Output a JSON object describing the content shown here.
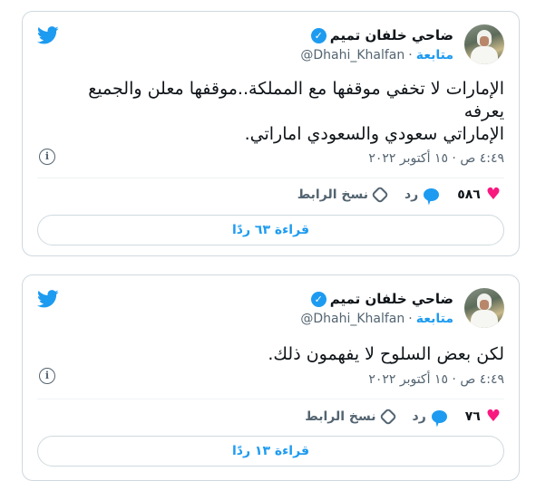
{
  "tweets": [
    {
      "author_name": "ضاحي خلفان تميم",
      "handle": "@Dhahi_Khalfan",
      "follow_label": "متابعة",
      "separator": "·",
      "text_lines": [
        "الإمارات لا تخفي موقفها مع المملكة..موقفها معلن والجميع",
        "يعرفه",
        "الإماراتي سعودي والسعودي اماراتي."
      ],
      "timestamp": "٤:٤٩ ص · ١٥ أكتوبر ٢٠٢٢",
      "likes": "٥٨٦",
      "reply_label": "رد",
      "copy_link_label": "نسخ الرابط",
      "read_replies_label": "قراءة ٦٣ ردًا"
    },
    {
      "author_name": "ضاحي خلفان تميم",
      "handle": "@Dhahi_Khalfan",
      "follow_label": "متابعة",
      "separator": "·",
      "text_lines": [
        "لكن بعض السلوح لا يفهمون ذلك."
      ],
      "timestamp": "٤:٤٩ ص · ١٥ أكتوبر ٢٠٢٢",
      "likes": "٧٦",
      "reply_label": "رد",
      "copy_link_label": "نسخ الرابط",
      "read_replies_label": "قراءة ١٣ ردًا"
    }
  ],
  "icons": {
    "brand": "twitter-bird-icon",
    "verified": "verified-badge-icon",
    "info": "info-icon",
    "like": "heart-icon",
    "reply": "reply-bubble-icon",
    "copy_link": "link-icon"
  },
  "colors": {
    "accent": "#1d9bf0",
    "like": "#f91880",
    "text": "#0f1419",
    "secondary": "#536471",
    "border": "#cfd9de"
  }
}
